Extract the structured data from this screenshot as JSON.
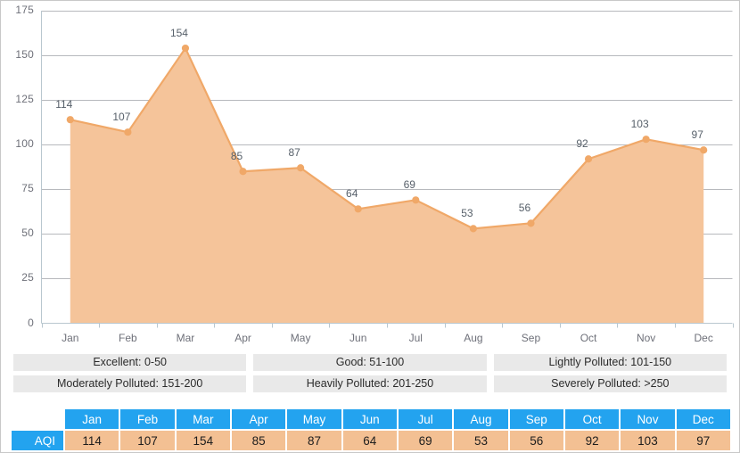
{
  "chart_data": {
    "type": "area",
    "title": "",
    "xlabel": "",
    "ylabel": "",
    "categories": [
      "Jan",
      "Feb",
      "Mar",
      "Apr",
      "May",
      "Jun",
      "Jul",
      "Aug",
      "Sep",
      "Oct",
      "Nov",
      "Dec"
    ],
    "series": [
      {
        "name": "AQI",
        "values": [
          114,
          107,
          154,
          85,
          87,
          64,
          69,
          53,
          56,
          92,
          103,
          97
        ]
      }
    ],
    "values": [
      114,
      107,
      154,
      85,
      87,
      64,
      69,
      53,
      56,
      92,
      103,
      97
    ],
    "ylim": [
      0,
      175
    ],
    "yticks": [
      0,
      25,
      50,
      75,
      100,
      125,
      150,
      175
    ],
    "ytick_labels": [
      "0",
      "25",
      "50",
      "75",
      "100",
      "125",
      "150",
      "175"
    ],
    "grid": true,
    "legend_position": "below-chart",
    "area_fill_color": "#f5c49a",
    "line_color": "#f0a868",
    "point_color": "#f0a868",
    "data_labels_shown": true
  },
  "legend": {
    "items": [
      {
        "label": "Excellent: 0-50"
      },
      {
        "label": "Good: 51-100"
      },
      {
        "label": "Lightly Polluted: 101-150"
      },
      {
        "label": "Moderately Polluted: 151-200"
      },
      {
        "label": "Heavily Polluted: 201-250"
      },
      {
        "label": "Severely Polluted: >250"
      }
    ]
  },
  "table": {
    "corner_label": "",
    "row_label": "AQI",
    "columns": [
      "Jan",
      "Feb",
      "Mar",
      "Apr",
      "May",
      "Jun",
      "Jul",
      "Aug",
      "Sep",
      "Oct",
      "Nov",
      "Dec"
    ],
    "values": [
      "114",
      "107",
      "154",
      "85",
      "87",
      "64",
      "69",
      "53",
      "56",
      "92",
      "103",
      "97"
    ],
    "header_color": "#23a3ef",
    "value_color": "#f3c093"
  }
}
